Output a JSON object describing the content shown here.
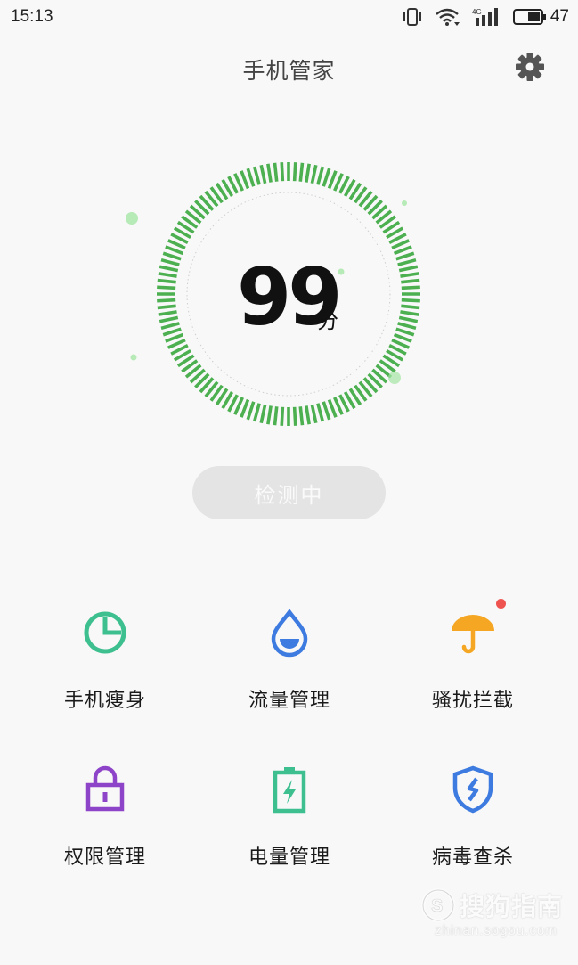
{
  "status_bar": {
    "time": "15:13",
    "network": "4G",
    "battery_percent": "47"
  },
  "header": {
    "title": "手机管家",
    "settings_icon": "gear-icon"
  },
  "score": {
    "value": "99",
    "unit": "分",
    "ring_color": "#4caf50"
  },
  "scan_button": {
    "label": "检测中"
  },
  "tools": [
    {
      "label": "手机瘦身",
      "icon": "pie-chart-icon",
      "color": "#3dbf8f"
    },
    {
      "label": "流量管理",
      "icon": "water-drop-icon",
      "color": "#3d7be0"
    },
    {
      "label": "骚扰拦截",
      "icon": "umbrella-icon",
      "color": "#f5a623",
      "badge": true
    },
    {
      "label": "权限管理",
      "icon": "lock-icon",
      "color": "#8e44c8"
    },
    {
      "label": "电量管理",
      "icon": "battery-icon",
      "color": "#3dbf8f"
    },
    {
      "label": "病毒查杀",
      "icon": "shield-icon",
      "color": "#3d7be0"
    }
  ],
  "watermark": {
    "main": "搜狗指南",
    "sub": "zhinan.sogou.com"
  }
}
